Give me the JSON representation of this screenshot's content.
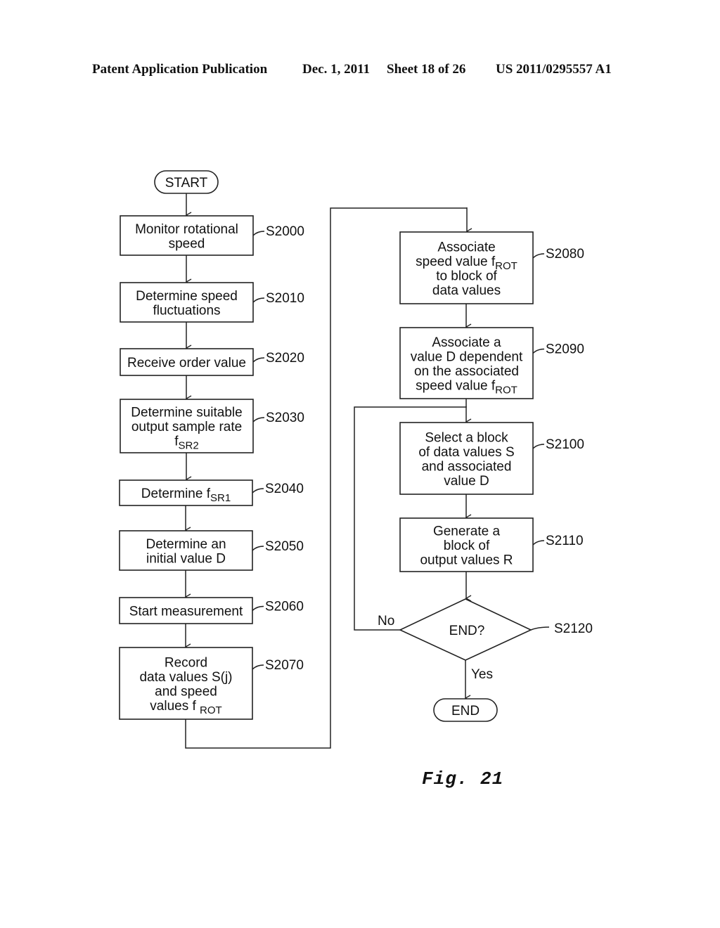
{
  "header": {
    "publication": "Patent Application Publication",
    "date": "Dec. 1, 2011",
    "sheet": "Sheet 18 of 26",
    "number": "US 2011/0295557 A1"
  },
  "figure_label": "Fig. 21",
  "flowchart": {
    "start": "START",
    "end": "END",
    "steps": [
      {
        "id": "S2000",
        "lines": [
          {
            "text": "Monitor rotational"
          },
          {
            "text": "speed"
          }
        ]
      },
      {
        "id": "S2010",
        "lines": [
          {
            "text": "Determine speed"
          },
          {
            "text": "fluctuations"
          }
        ]
      },
      {
        "id": "S2020",
        "lines": [
          {
            "text": "Receive order value"
          }
        ]
      },
      {
        "id": "S2030",
        "lines": [
          {
            "text": "Determine suitable"
          },
          {
            "text": "output sample rate"
          },
          {
            "text": "f",
            "sub": "SR2"
          }
        ]
      },
      {
        "id": "S2040",
        "lines": [
          {
            "text": "Determine f",
            "sub": "SR1"
          }
        ]
      },
      {
        "id": "S2050",
        "lines": [
          {
            "text": "Determine an"
          },
          {
            "text": "initial value D"
          }
        ]
      },
      {
        "id": "S2060",
        "lines": [
          {
            "text": "Start measurement"
          }
        ]
      },
      {
        "id": "S2070",
        "lines": [
          {
            "text": "Record"
          },
          {
            "text": "data values S(j)"
          },
          {
            "text": "and speed"
          },
          {
            "text": "values f ",
            "sub": "ROT"
          }
        ]
      },
      {
        "id": "S2080",
        "lines": [
          {
            "text": "Associate"
          },
          {
            "text": "speed value f",
            "sub": "ROT"
          },
          {
            "text": "to block of"
          },
          {
            "text": "data values"
          }
        ]
      },
      {
        "id": "S2090",
        "lines": [
          {
            "text": "Associate a"
          },
          {
            "text": "value D dependent"
          },
          {
            "text": "on the associated"
          },
          {
            "text": "speed value f",
            "sub": "ROT"
          }
        ]
      },
      {
        "id": "S2100",
        "lines": [
          {
            "text": "Select a block"
          },
          {
            "text": "of data values S"
          },
          {
            "text": "and associated"
          },
          {
            "text": "value D"
          }
        ]
      },
      {
        "id": "S2110",
        "lines": [
          {
            "text": "Generate a"
          },
          {
            "text": "block of"
          },
          {
            "text": "output values R"
          }
        ]
      }
    ],
    "decision": {
      "id": "S2120",
      "text": "END?",
      "no_label": "No",
      "yes_label": "Yes"
    }
  }
}
